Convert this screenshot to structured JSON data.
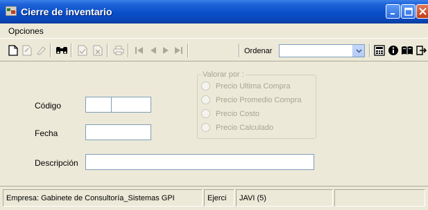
{
  "window": {
    "title": "Cierre de inventario",
    "accent": "#0a4fc9"
  },
  "menu": {
    "options_label": "Opciones"
  },
  "toolbar": {
    "tools": [
      "new-icon",
      "edit-icon",
      "erase-icon",
      "search-binoculars-icon",
      "accept-icon",
      "cancel-icon",
      "print-icon",
      "first-record-icon",
      "previous-record-icon",
      "next-record-icon",
      "last-record-icon",
      "calculator-icon",
      "info-icon",
      "book-icon",
      "exit-icon"
    ],
    "order_label": "Ordenar",
    "order_value": ""
  },
  "form": {
    "codigo_label": "Código",
    "codigo_value_1": "",
    "codigo_value_2": "",
    "fecha_label": "Fecha",
    "fecha_value": "",
    "descripcion_label": "Descripción",
    "descripcion_value": ""
  },
  "valorar": {
    "legend": "Valorar por :",
    "options": [
      "Precio Ultima Compra",
      "Precio Promedio Compra",
      "Precio Costo",
      "Precio Calculado"
    ]
  },
  "status": {
    "empresa": "Empresa: Gabinete de Consultoría_Sistemas GPI",
    "ejerci": "Ejerci",
    "user": "JAVI  (5)",
    "extra": ""
  }
}
